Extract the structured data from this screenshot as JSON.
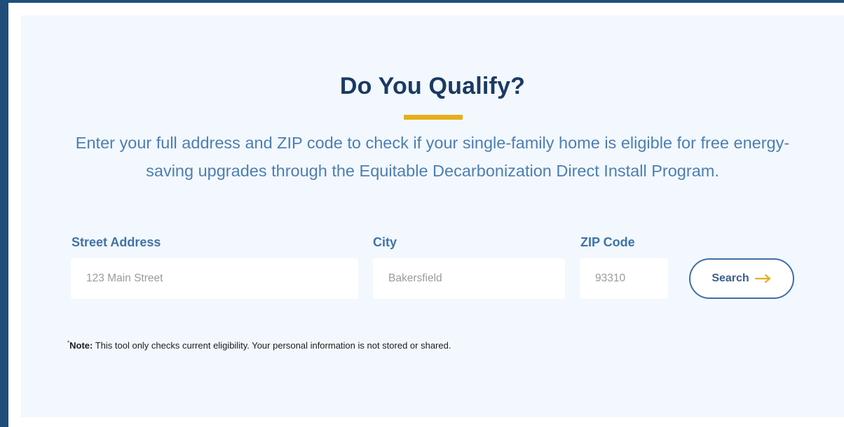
{
  "heading": {
    "title": "Do You Qualify?",
    "description": "Enter your full address and ZIP code to check if your single-family home is eligible for free energy-saving upgrades through the Equitable Decarbonization Direct Install Program."
  },
  "form": {
    "street": {
      "label": "Street Address",
      "placeholder": "123 Main Street",
      "value": ""
    },
    "city": {
      "label": "City",
      "placeholder": "Bakersfield",
      "value": ""
    },
    "zip": {
      "label": "ZIP Code",
      "placeholder": "93310",
      "value": ""
    },
    "search_label": "Search",
    "search_icon": "arrow-right-icon"
  },
  "note": {
    "marker": "*",
    "label": "Note:",
    "text": " This tool only checks current eligibility. Your personal information is not stored or shared."
  },
  "colors": {
    "frame": "#1f4e7a",
    "card_background": "#f2f8fd",
    "title": "#1a3a63",
    "accent": "#e8ad1b",
    "body_text": "#4d7eb3",
    "label": "#3f73a8",
    "button_border": "#3f6ea8"
  }
}
